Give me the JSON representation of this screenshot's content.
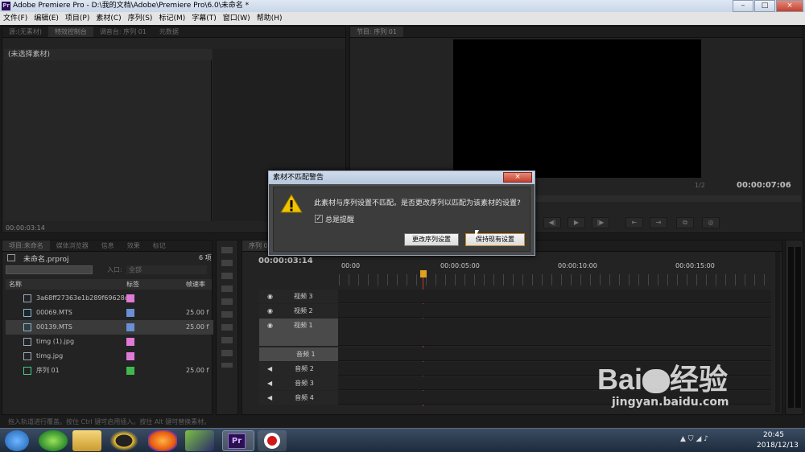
{
  "window": {
    "title": "Adobe Premiere Pro - D:\\我的文档\\Adobe\\Premiere Pro\\6.0\\未命名 *",
    "app_icon": "Pr"
  },
  "window_controls": [
    "–",
    "□",
    "×"
  ],
  "menu": [
    "文件(F)",
    "编辑(E)",
    "项目(P)",
    "素材(C)",
    "序列(S)",
    "标记(M)",
    "字幕(T)",
    "窗口(W)",
    "帮助(H)"
  ],
  "source_panel": {
    "tabs": [
      "源:(无素材)",
      "特效控制台",
      "调音台: 序列 01",
      "元数据"
    ],
    "no_clip": "(未选择素材)",
    "timecode": "00:00:03:14"
  },
  "program_panel": {
    "tab": "节目: 序列 01",
    "zoom": "1/2",
    "timecode": "00:00:07:06",
    "controls": [
      "|◀",
      "◀|",
      "▶",
      "|▶",
      "▶|",
      "⇤",
      "⇥",
      "⧉",
      "⊡",
      "◎"
    ]
  },
  "project_panel": {
    "tabs": [
      "项目:未命名",
      "媒体浏览器",
      "信息",
      "效果",
      "标记"
    ],
    "project_name": "未命名.prproj",
    "item_count": "6 项",
    "in_label": "入口:",
    "in_value": "全部",
    "columns": [
      "名称",
      "标签",
      "帧速率"
    ],
    "items": [
      {
        "name": "3a68ff27363e1b289f69628c",
        "label_color": "#e07ad8",
        "fps": ""
      },
      {
        "name": "00069.MTS",
        "label_color": "#6b8fd6",
        "fps": "25.00 f"
      },
      {
        "name": "00139.MTS",
        "label_color": "#6b8fd6",
        "fps": "25.00 f"
      },
      {
        "name": "timg (1).jpg",
        "label_color": "#e07ad8",
        "fps": ""
      },
      {
        "name": "timg.jpg",
        "label_color": "#e07ad8",
        "fps": ""
      },
      {
        "name": "序列 01",
        "label_color": "#3fb84e",
        "fps": "25.00 f"
      }
    ]
  },
  "timeline": {
    "tab": "序列 01",
    "timecode": "00:00:03:14",
    "ruler": [
      "00:00",
      "00:00:05:00",
      "00:00:10:00",
      "00:00:15:00"
    ],
    "tracks": [
      {
        "name": "视频 3",
        "kind": "video"
      },
      {
        "name": "视频 2",
        "kind": "video"
      },
      {
        "name": "视频 1",
        "kind": "video"
      },
      {
        "name": "音频 1",
        "kind": "audio"
      },
      {
        "name": "音频 2",
        "kind": "audio"
      },
      {
        "name": "音频 3",
        "kind": "audio"
      },
      {
        "name": "音频 4",
        "kind": "audio"
      }
    ]
  },
  "dialog": {
    "title": "素材不匹配警告",
    "close": "×",
    "message": "此素材与序列设置不匹配。是否更改序列以匹配为该素材的设置?",
    "checkbox_label": "总是提醒",
    "checkbox_checked": true,
    "btn_change": "更改序列设置",
    "btn_keep": "保持现有设置"
  },
  "status": "拖入轨道进行覆盖。按住 Ctrl 键可启用插入。按住 Alt 键可替换素材。",
  "taskbar": {
    "time": "20:45",
    "date": "2018/12/13",
    "apps": [
      "windows-start",
      "360-browser",
      "file-explorer",
      "qq",
      "firefox",
      "camtasia",
      "premiere-pro",
      "recorder"
    ],
    "premiere_label": "Pr"
  },
  "watermark": {
    "brand": "Bai",
    "cn": "经验",
    "url": "jingyan.baidu.com"
  }
}
